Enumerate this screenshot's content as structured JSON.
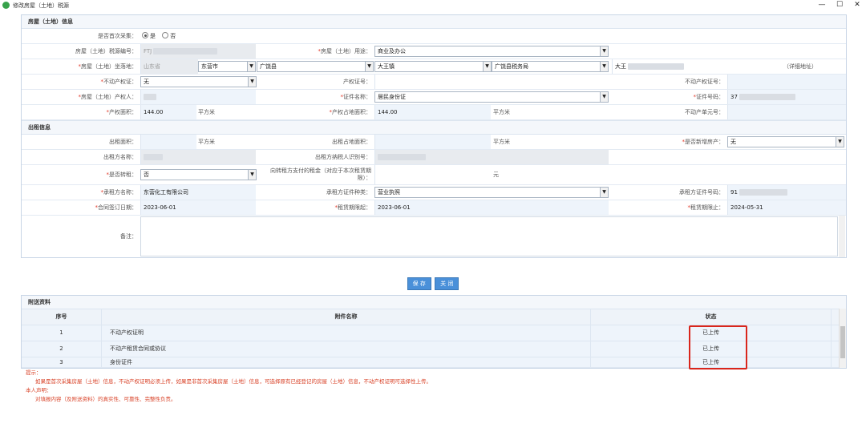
{
  "window": {
    "title": "修改房屋（土地）税源",
    "minimize": "—",
    "maximize": "☐",
    "close": "✕"
  },
  "house_section": {
    "heading": "房屋（土地）信息",
    "first_collect": {
      "label": "是否首次采集：",
      "options": [
        "是",
        "否"
      ],
      "selected": "是"
    },
    "source_no": {
      "label": "房屋（土地）税源编号：",
      "value": "FTJ"
    },
    "usage": {
      "label": "房屋（土地）用途：",
      "value": "商业及办公"
    },
    "location": {
      "label": "房屋（土地）坐落地：",
      "province": "山东省",
      "city": "东营市",
      "county": "广饶县",
      "town": "大王镇",
      "bureau": "广饶县税务局",
      "street": "大王",
      "detail_hint": "（详细地址）"
    },
    "property_cert": {
      "label": "不动产权证：",
      "value": "无"
    },
    "right_cert_no": {
      "label": "产权证号：",
      "value": ""
    },
    "realty_cert_no": {
      "label": "不动产权证号：",
      "value": ""
    },
    "owner": {
      "label": "房屋（土地）产权人：",
      "value": ""
    },
    "id_type": {
      "label": "证件名称：",
      "value": "居民身份证"
    },
    "id_no": {
      "label": "证件号码：",
      "value": "37"
    },
    "area": {
      "label": "产权面积：",
      "value": "144.00",
      "unit": "平方米"
    },
    "land_area": {
      "label": "产权占地面积：",
      "value": "144.00",
      "unit": "平方米"
    },
    "unit_no": {
      "label": "不动产单元号：",
      "value": ""
    }
  },
  "rent_section": {
    "heading": "出租信息",
    "rent_area": {
      "label": "出租面积：",
      "value": "",
      "unit": "平方米"
    },
    "rent_land_area": {
      "label": "出租占地面积：",
      "value": "",
      "unit": "平方米"
    },
    "is_second_hand": {
      "label": "是否新增房产：",
      "value": "无"
    },
    "lessor_name": {
      "label": "出租方名称：",
      "value": ""
    },
    "lessor_tax_id": {
      "label": "出租方纳税人识别号：",
      "value": ""
    },
    "is_sublease": {
      "label": "是否转租：",
      "value": "否"
    },
    "sublease_rent": {
      "label": "向转租方支付的租金（对应于本次租赁期限）：",
      "value": "",
      "unit": "元"
    },
    "lessee_name": {
      "label": "承租方名称：",
      "value": "东营化工有限公司"
    },
    "lessee_id_type": {
      "label": "承租方证件种类：",
      "value": "营业执照"
    },
    "lessee_id_no": {
      "label": "承租方证件号码：",
      "value": "91"
    },
    "contract_date": {
      "label": "合同签订日期：",
      "value": "2023-06-01"
    },
    "rent_start": {
      "label": "租赁期限起：",
      "value": "2023-06-01"
    },
    "rent_end": {
      "label": "租赁期限止：",
      "value": "2024-05-31"
    },
    "remark": {
      "label": "备注：",
      "value": ""
    }
  },
  "buttons": {
    "save": "保 存",
    "close": "关 闭"
  },
  "attachments": {
    "heading": "附送资料",
    "columns": [
      "序号",
      "附件名称",
      "状态"
    ],
    "rows": [
      {
        "no": "1",
        "name": "不动产权证明",
        "status": "已上传"
      },
      {
        "no": "2",
        "name": "不动产租赁合同或协议",
        "status": "已上传"
      },
      {
        "no": "3",
        "name": "身份证件",
        "status": "已上传"
      }
    ]
  },
  "hint": {
    "title": "提示：",
    "line1": "如果是首次采集房屋（土地）信息，不动产权证明必须上传，如果是非首次采集房屋（土地）信息，可选择原有已经登记的房屋（土地）信息，不动产权证明可选择性上传。",
    "title2": "本人声明：",
    "line2": "对填报内容（及附送资料）的真实性、可靠性、完整性负责。"
  },
  "colors": {
    "accent": "#4a90d9",
    "highlight_box": "#d9261c",
    "hint_text": "#d9442a"
  }
}
